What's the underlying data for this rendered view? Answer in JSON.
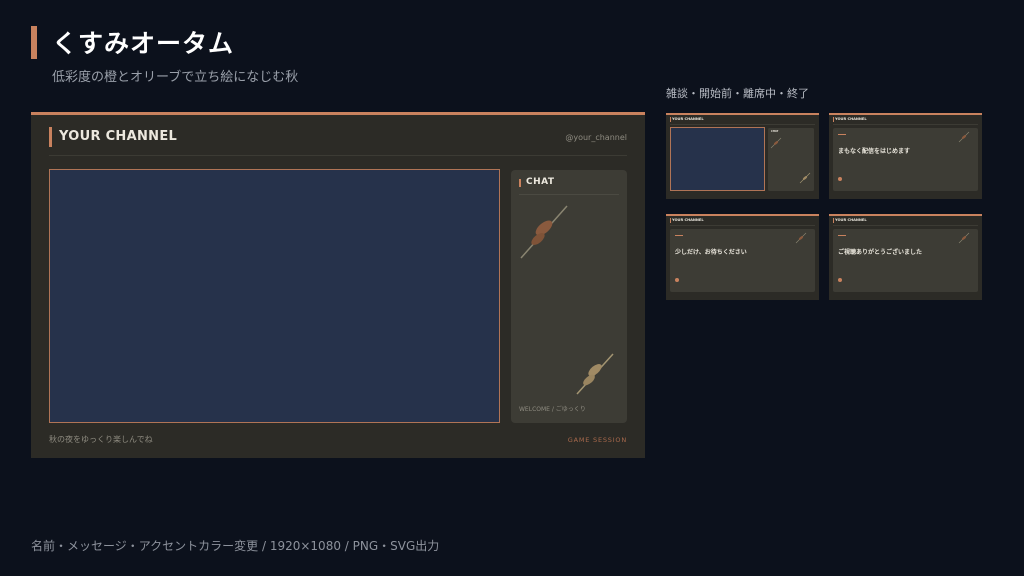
{
  "header": {
    "title": "くすみオータム",
    "subtitle": "低彩度の橙とオリーブで立ち絵になじむ秋"
  },
  "variants_label": "雑談・開始前・離席中・終了",
  "preview": {
    "channel_name": "YOUR CHANNEL",
    "handle": "@your_channel",
    "chat_title": "CHAT",
    "chat_welcome": "WELCOME / ごゆっくり",
    "message": "秋の夜をゆっくり楽しんでね",
    "session_label": "GAME SESSION"
  },
  "thumbnails": [
    {
      "variant": "雑談",
      "channel_name": "YOUR CHANNEL",
      "chat_title": "CHAT"
    },
    {
      "variant": "開始前",
      "channel_name": "YOUR CHANNEL",
      "main_text": "まもなく配信をはじめます"
    },
    {
      "variant": "離席中",
      "channel_name": "YOUR CHANNEL",
      "main_text": "少しだけ、お待ちください"
    },
    {
      "variant": "終了",
      "channel_name": "YOUR CHANNEL",
      "main_text": "ご視聴ありがとうございました"
    }
  ],
  "footer": "名前・メッセージ・アクセントカラー変更 / 1920×1080 / PNG・SVG出力",
  "colors": {
    "background": "#0c111c",
    "accent": "#c9825e",
    "panel": "#2c2b26",
    "card": "#3d3c35",
    "video": "#26324b"
  }
}
